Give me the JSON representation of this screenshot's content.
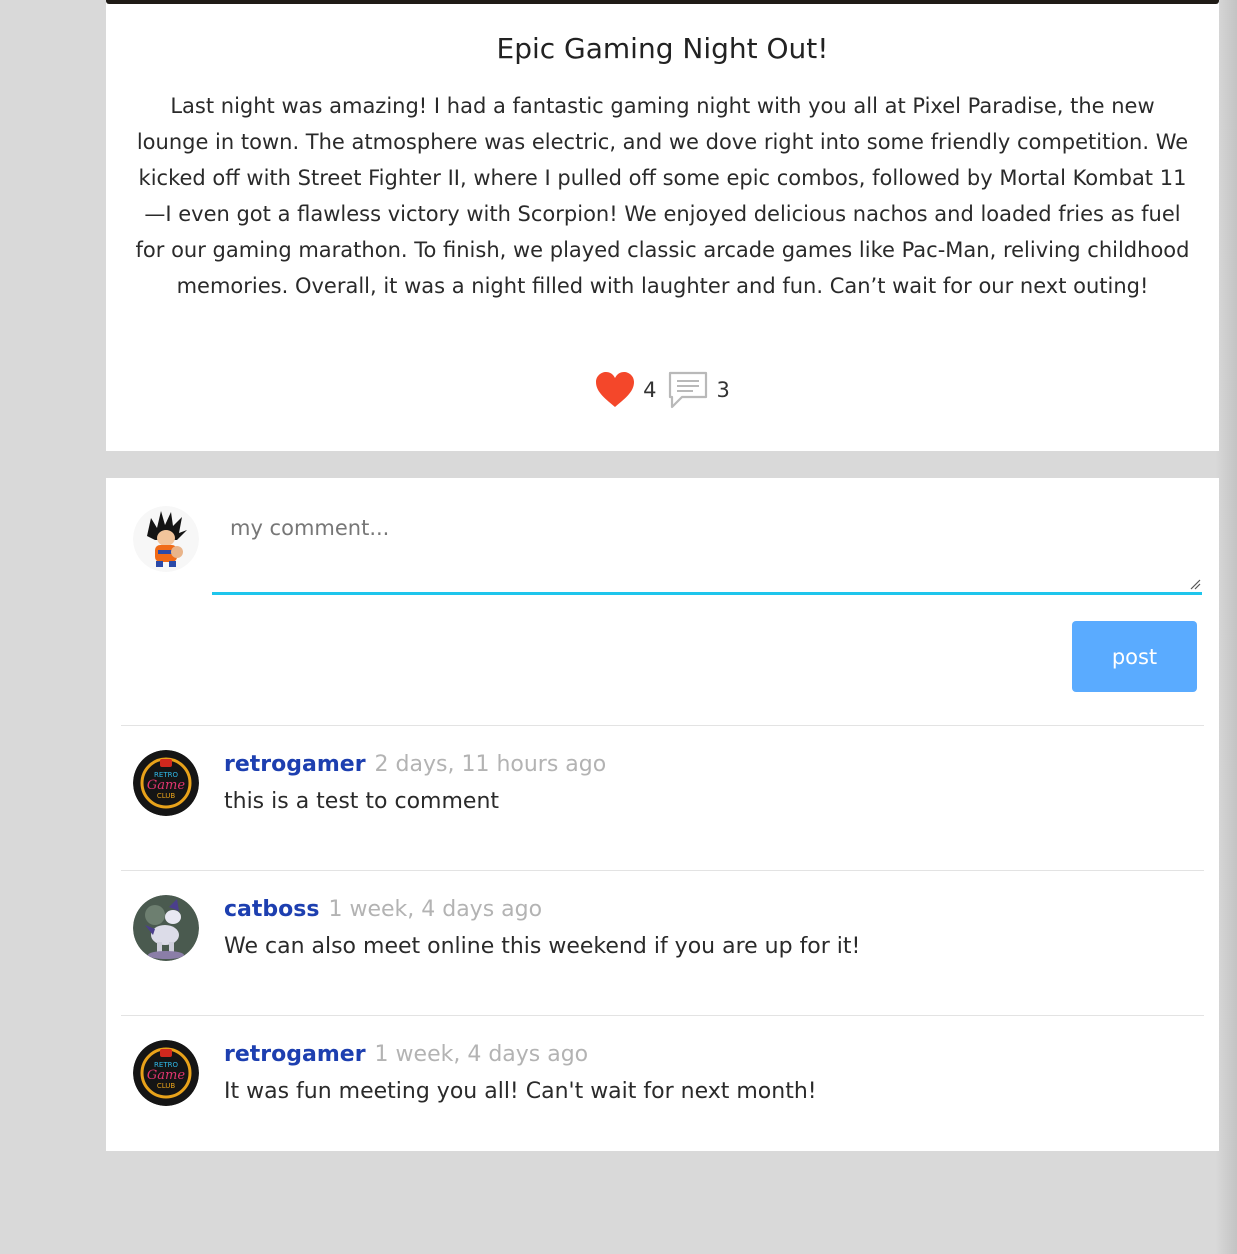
{
  "post": {
    "title": "Epic Gaming Night Out!",
    "body": "Last night was amazing! I had a fantastic gaming night with you all at Pixel Paradise, the new lounge in town. The atmosphere was electric, and we dove right into some friendly competition. We kicked off with Street Fighter II, where I pulled off some epic combos, followed by Mortal Kombat 11—I even got a flawless victory with Scorpion! We enjoyed delicious nachos and loaded fries as fuel for our gaming marathon. To finish, we played classic arcade games like Pac-Man, reliving childhood memories. Overall, it was a night filled with laughter and fun. Can’t wait for our next outing!",
    "likes": "4",
    "comments_count": "3",
    "icons": {
      "like": "heart-icon",
      "comments": "speech-bubble-icon"
    }
  },
  "comment_form": {
    "placeholder": "my comment...",
    "post_label": "post",
    "avatar": "goku-avatar"
  },
  "comments": [
    {
      "username": "retrogamer",
      "time": "2 days, 11 hours ago",
      "text": "this is a test to comment",
      "avatar": "retro-game-club-avatar"
    },
    {
      "username": "catboss",
      "time": "1 week, 4 days ago",
      "text": "We can also meet online this weekend if you are up for it!",
      "avatar": "creature-avatar"
    },
    {
      "username": "retrogamer",
      "time": "1 week, 4 days ago",
      "text": "It was fun meeting you all! Can't wait for next month!",
      "avatar": "retro-game-club-avatar"
    }
  ],
  "colors": {
    "page_bg": "#d9d9d9",
    "card_bg": "#ffffff",
    "heart": "#f4472a",
    "username": "#1d3fb0",
    "timestamp": "#b3b3b3",
    "input_focus": "#1ec5ec",
    "post_button": "#5aabff"
  }
}
